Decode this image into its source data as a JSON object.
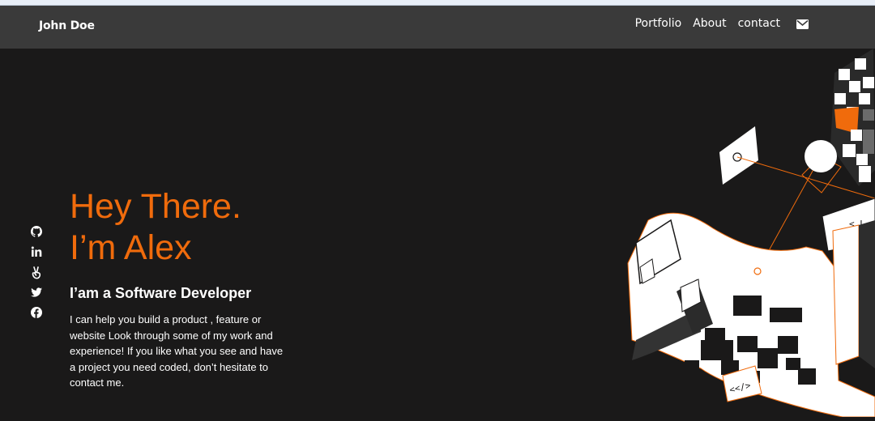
{
  "nav": {
    "brand": "John Doe",
    "links": [
      "Portfolio",
      "About",
      "contact"
    ],
    "mail_icon": "envelope-icon"
  },
  "social": [
    "github-icon",
    "linkedin-icon",
    "angellist-icon",
    "twitter-icon",
    "facebook-icon"
  ],
  "hero": {
    "line1": "Hey There.",
    "line2": "I’m Alex",
    "subtitle": "I’am a Software Developer",
    "description": "I can help you build a product , feature or website Look through some of my work and experience! If you like what you see and have a project you need coded, don’t hesitate to contact me."
  },
  "illustration": {
    "code_tag_1": "<</>",
    "code_tag_2": "<_L"
  },
  "colors": {
    "background": "#1a1919",
    "navbar": "#3a3a3a",
    "accent": "#f06b0c",
    "text": "#ffffff"
  }
}
